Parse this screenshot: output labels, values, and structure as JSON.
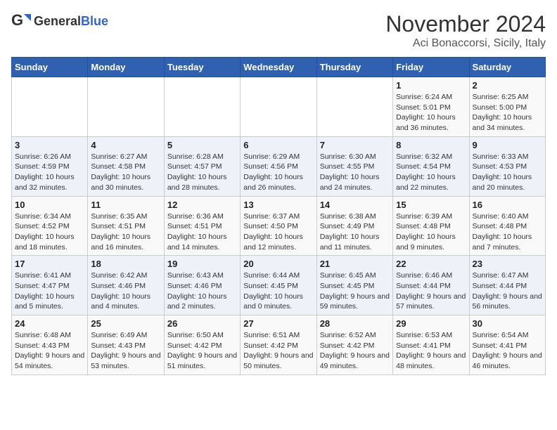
{
  "header": {
    "logo_general": "General",
    "logo_blue": "Blue",
    "month_title": "November 2024",
    "location": "Aci Bonaccorsi, Sicily, Italy"
  },
  "days_of_week": [
    "Sunday",
    "Monday",
    "Tuesday",
    "Wednesday",
    "Thursday",
    "Friday",
    "Saturday"
  ],
  "weeks": [
    [
      {
        "day": "",
        "info": ""
      },
      {
        "day": "",
        "info": ""
      },
      {
        "day": "",
        "info": ""
      },
      {
        "day": "",
        "info": ""
      },
      {
        "day": "",
        "info": ""
      },
      {
        "day": "1",
        "info": "Sunrise: 6:24 AM\nSunset: 5:01 PM\nDaylight: 10 hours and 36 minutes."
      },
      {
        "day": "2",
        "info": "Sunrise: 6:25 AM\nSunset: 5:00 PM\nDaylight: 10 hours and 34 minutes."
      }
    ],
    [
      {
        "day": "3",
        "info": "Sunrise: 6:26 AM\nSunset: 4:59 PM\nDaylight: 10 hours and 32 minutes."
      },
      {
        "day": "4",
        "info": "Sunrise: 6:27 AM\nSunset: 4:58 PM\nDaylight: 10 hours and 30 minutes."
      },
      {
        "day": "5",
        "info": "Sunrise: 6:28 AM\nSunset: 4:57 PM\nDaylight: 10 hours and 28 minutes."
      },
      {
        "day": "6",
        "info": "Sunrise: 6:29 AM\nSunset: 4:56 PM\nDaylight: 10 hours and 26 minutes."
      },
      {
        "day": "7",
        "info": "Sunrise: 6:30 AM\nSunset: 4:55 PM\nDaylight: 10 hours and 24 minutes."
      },
      {
        "day": "8",
        "info": "Sunrise: 6:32 AM\nSunset: 4:54 PM\nDaylight: 10 hours and 22 minutes."
      },
      {
        "day": "9",
        "info": "Sunrise: 6:33 AM\nSunset: 4:53 PM\nDaylight: 10 hours and 20 minutes."
      }
    ],
    [
      {
        "day": "10",
        "info": "Sunrise: 6:34 AM\nSunset: 4:52 PM\nDaylight: 10 hours and 18 minutes."
      },
      {
        "day": "11",
        "info": "Sunrise: 6:35 AM\nSunset: 4:51 PM\nDaylight: 10 hours and 16 minutes."
      },
      {
        "day": "12",
        "info": "Sunrise: 6:36 AM\nSunset: 4:51 PM\nDaylight: 10 hours and 14 minutes."
      },
      {
        "day": "13",
        "info": "Sunrise: 6:37 AM\nSunset: 4:50 PM\nDaylight: 10 hours and 12 minutes."
      },
      {
        "day": "14",
        "info": "Sunrise: 6:38 AM\nSunset: 4:49 PM\nDaylight: 10 hours and 11 minutes."
      },
      {
        "day": "15",
        "info": "Sunrise: 6:39 AM\nSunset: 4:48 PM\nDaylight: 10 hours and 9 minutes."
      },
      {
        "day": "16",
        "info": "Sunrise: 6:40 AM\nSunset: 4:48 PM\nDaylight: 10 hours and 7 minutes."
      }
    ],
    [
      {
        "day": "17",
        "info": "Sunrise: 6:41 AM\nSunset: 4:47 PM\nDaylight: 10 hours and 5 minutes."
      },
      {
        "day": "18",
        "info": "Sunrise: 6:42 AM\nSunset: 4:46 PM\nDaylight: 10 hours and 4 minutes."
      },
      {
        "day": "19",
        "info": "Sunrise: 6:43 AM\nSunset: 4:46 PM\nDaylight: 10 hours and 2 minutes."
      },
      {
        "day": "20",
        "info": "Sunrise: 6:44 AM\nSunset: 4:45 PM\nDaylight: 10 hours and 0 minutes."
      },
      {
        "day": "21",
        "info": "Sunrise: 6:45 AM\nSunset: 4:45 PM\nDaylight: 9 hours and 59 minutes."
      },
      {
        "day": "22",
        "info": "Sunrise: 6:46 AM\nSunset: 4:44 PM\nDaylight: 9 hours and 57 minutes."
      },
      {
        "day": "23",
        "info": "Sunrise: 6:47 AM\nSunset: 4:44 PM\nDaylight: 9 hours and 56 minutes."
      }
    ],
    [
      {
        "day": "24",
        "info": "Sunrise: 6:48 AM\nSunset: 4:43 PM\nDaylight: 9 hours and 54 minutes."
      },
      {
        "day": "25",
        "info": "Sunrise: 6:49 AM\nSunset: 4:43 PM\nDaylight: 9 hours and 53 minutes."
      },
      {
        "day": "26",
        "info": "Sunrise: 6:50 AM\nSunset: 4:42 PM\nDaylight: 9 hours and 51 minutes."
      },
      {
        "day": "27",
        "info": "Sunrise: 6:51 AM\nSunset: 4:42 PM\nDaylight: 9 hours and 50 minutes."
      },
      {
        "day": "28",
        "info": "Sunrise: 6:52 AM\nSunset: 4:42 PM\nDaylight: 9 hours and 49 minutes."
      },
      {
        "day": "29",
        "info": "Sunrise: 6:53 AM\nSunset: 4:41 PM\nDaylight: 9 hours and 48 minutes."
      },
      {
        "day": "30",
        "info": "Sunrise: 6:54 AM\nSunset: 4:41 PM\nDaylight: 9 hours and 46 minutes."
      }
    ]
  ]
}
